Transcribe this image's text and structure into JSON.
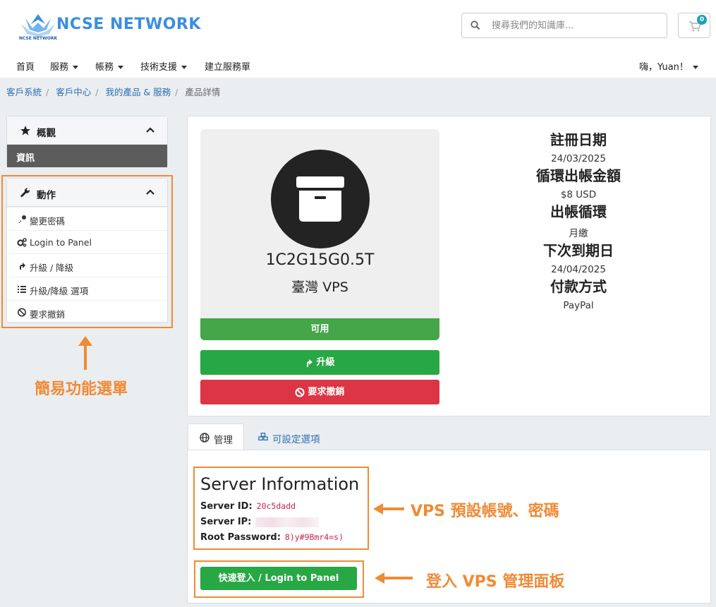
{
  "header": {
    "brand": "NCSE NETWORK",
    "logo_text": "NCSE NETWORK",
    "search_placeholder": "搜尋我們的知識庫...",
    "cart_count": "0"
  },
  "nav": {
    "items": [
      {
        "label": "首頁",
        "dropdown": false
      },
      {
        "label": "服務",
        "dropdown": true
      },
      {
        "label": "帳務",
        "dropdown": true
      },
      {
        "label": "技術支援",
        "dropdown": true
      },
      {
        "label": "建立服務單",
        "dropdown": false
      }
    ],
    "user_greeting": "嗨，Yuan！"
  },
  "breadcrumb": {
    "items": [
      "客戶系統",
      "客戶中心",
      "我的產品 & 服務"
    ],
    "current": "產品詳情"
  },
  "sidebar": {
    "overview": {
      "title": "概觀",
      "active_item": "資訊"
    },
    "actions": {
      "title": "動作",
      "items": [
        {
          "label": "變更密碼",
          "icon": "key-icon"
        },
        {
          "label": "Login to Panel",
          "icon": "gears-icon"
        },
        {
          "label": "升級 / 降級",
          "icon": "arrow-up-icon"
        },
        {
          "label": "升級/降級 選項",
          "icon": "list-icon"
        },
        {
          "label": "要求撤銷",
          "icon": "ban-icon"
        }
      ]
    }
  },
  "annotations": {
    "menu": "簡易功能選單",
    "credentials": "VPS 預設帳號、密碼",
    "panel": "登入 VPS 管理面板"
  },
  "product": {
    "name": "1C2G15G0.5T",
    "type": "臺灣 VPS",
    "status": "可用",
    "upgrade_label": "升級",
    "cancel_label": "要求撤銷"
  },
  "info": {
    "reg_date_label": "註冊日期",
    "reg_date": "24/03/2025",
    "recurring_label": "循環出帳金額",
    "recurring": "$8 USD",
    "cycle_label": "出帳循環",
    "cycle": "月繳",
    "next_due_label": "下次到期日",
    "next_due": "24/04/2025",
    "payment_label": "付款方式",
    "payment": "PayPal"
  },
  "tabs": {
    "manage": "管理",
    "options": "可設定選項"
  },
  "server": {
    "title": "Server Information",
    "id_label": "Server ID:",
    "id_value": "20c5dadd",
    "ip_label": "Server IP:",
    "pw_label": "Root Password:",
    "pw_value": "8)y#9Bmr4=s)",
    "login_button": "快速登入 / Login to Panel"
  },
  "colors": {
    "accent": "#f08a35",
    "green": "#28a745",
    "red": "#dc3545",
    "link": "#2d6fb4"
  }
}
